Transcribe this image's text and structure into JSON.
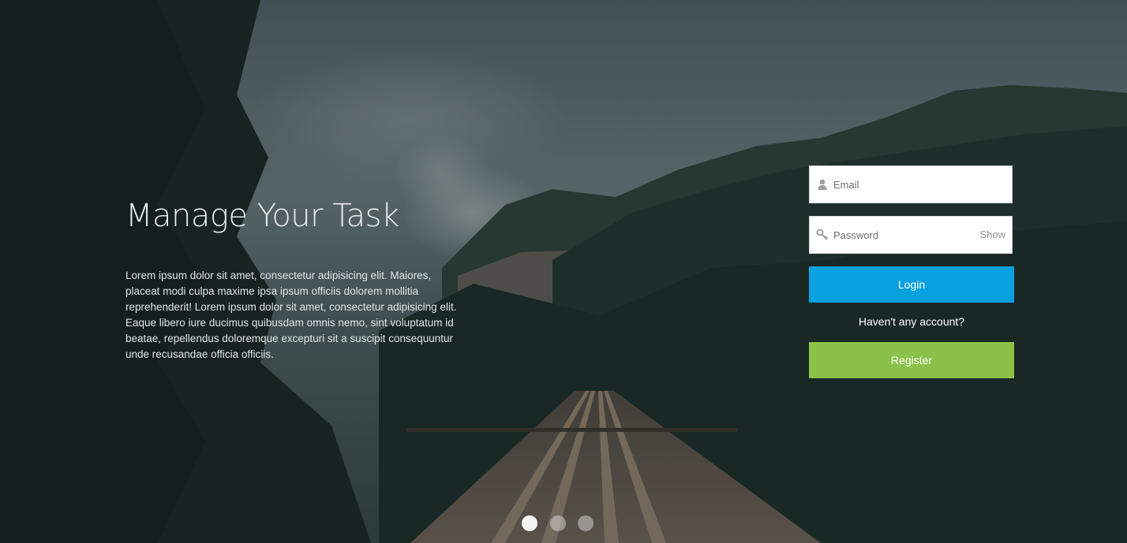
{
  "hero": {
    "title": "Manage Your Task",
    "description": "Lorem ipsum dolor sit amet, consectetur adipisicing elit. Maiores, placeat modi culpa maxime ipsa ipsum officiis dolorem mollitia reprehenderit! Lorem ipsum dolor sit amet, consectetur adipisicing elit. Eaque libero iure ducimus quibusdam omnis nemo, sint voluptatum id beatae, repellendus doloremque excepturi sit a suscipit consequuntur unde recusandae officia officiis."
  },
  "login_form": {
    "email": {
      "placeholder": "Email",
      "value": "",
      "icon": "user-icon"
    },
    "password": {
      "placeholder": "Password",
      "value": "",
      "icon": "key-icon",
      "show_label": "Show"
    },
    "login_label": "Login",
    "no_account_text": "Haven't any account?",
    "register_label": "Register"
  },
  "carousel": {
    "slide_count": 3,
    "active_slide": 1
  },
  "colors": {
    "login_button": "#0aa1e0",
    "register_button": "#8bc148"
  }
}
